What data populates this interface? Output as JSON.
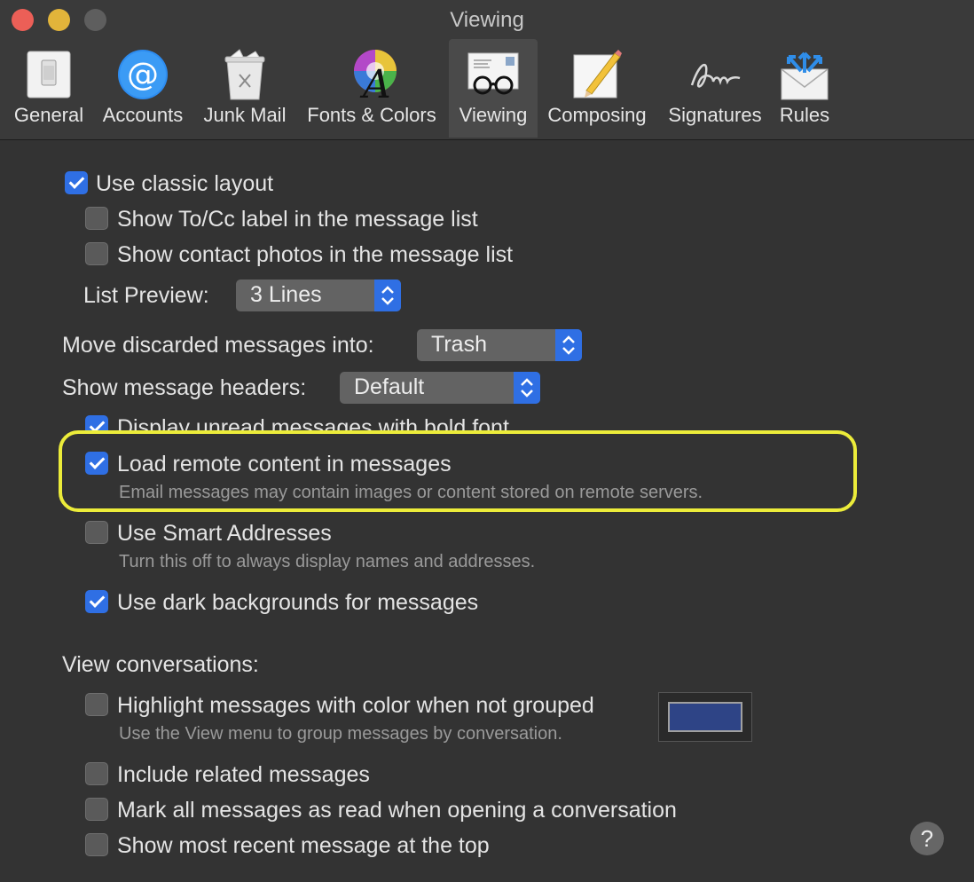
{
  "window": {
    "title": "Viewing"
  },
  "toolbar": {
    "items": [
      {
        "label": "General",
        "icon": "general-switch-icon"
      },
      {
        "label": "Accounts",
        "icon": "at-sign-icon"
      },
      {
        "label": "Junk Mail",
        "icon": "trash-bin-icon"
      },
      {
        "label": "Fonts & Colors",
        "icon": "font-color-wheel-icon"
      },
      {
        "label": "Viewing",
        "icon": "glasses-letter-icon",
        "selected": true
      },
      {
        "label": "Composing",
        "icon": "pencil-paper-icon"
      },
      {
        "label": "Signatures",
        "icon": "signature-icon"
      },
      {
        "label": "Rules",
        "icon": "envelope-arrows-icon"
      }
    ]
  },
  "settings": {
    "classic_layout": {
      "label": "Use classic layout",
      "checked": true
    },
    "show_tocc": {
      "label": "Show To/Cc label in the message list",
      "checked": false
    },
    "show_photos": {
      "label": "Show contact photos in the message list",
      "checked": false
    },
    "list_preview": {
      "label": "List Preview:",
      "value": "3 Lines"
    },
    "move_discarded": {
      "label": "Move discarded messages into:",
      "value": "Trash"
    },
    "message_headers": {
      "label": "Show message headers:",
      "value": "Default"
    },
    "display_unread": {
      "label": "Display unread messages with bold font",
      "checked": true
    },
    "remote_content": {
      "label": "Load remote content in messages",
      "checked": true,
      "description": "Email messages may contain images or content stored on remote servers."
    },
    "smart_addresses": {
      "label": "Use Smart Addresses",
      "checked": false,
      "description": "Turn this off to always display names and addresses."
    },
    "dark_backgrounds": {
      "label": "Use dark backgrounds for messages",
      "checked": true
    },
    "view_conversations": {
      "label": "View conversations:"
    },
    "highlight_color": {
      "label": "Highlight messages with color when not grouped",
      "checked": false,
      "description": "Use the View menu to group messages by conversation.",
      "color": "#2e4486"
    },
    "include_related": {
      "label": "Include related messages",
      "checked": false
    },
    "mark_all_read": {
      "label": "Mark all messages as read when opening a conversation",
      "checked": false
    },
    "most_recent_top": {
      "label": "Show most recent message at the top",
      "checked": false
    }
  },
  "help": {
    "label": "?"
  },
  "colors": {
    "accent": "#2f6fe4",
    "highlight_annotation": "#ecec3a"
  }
}
